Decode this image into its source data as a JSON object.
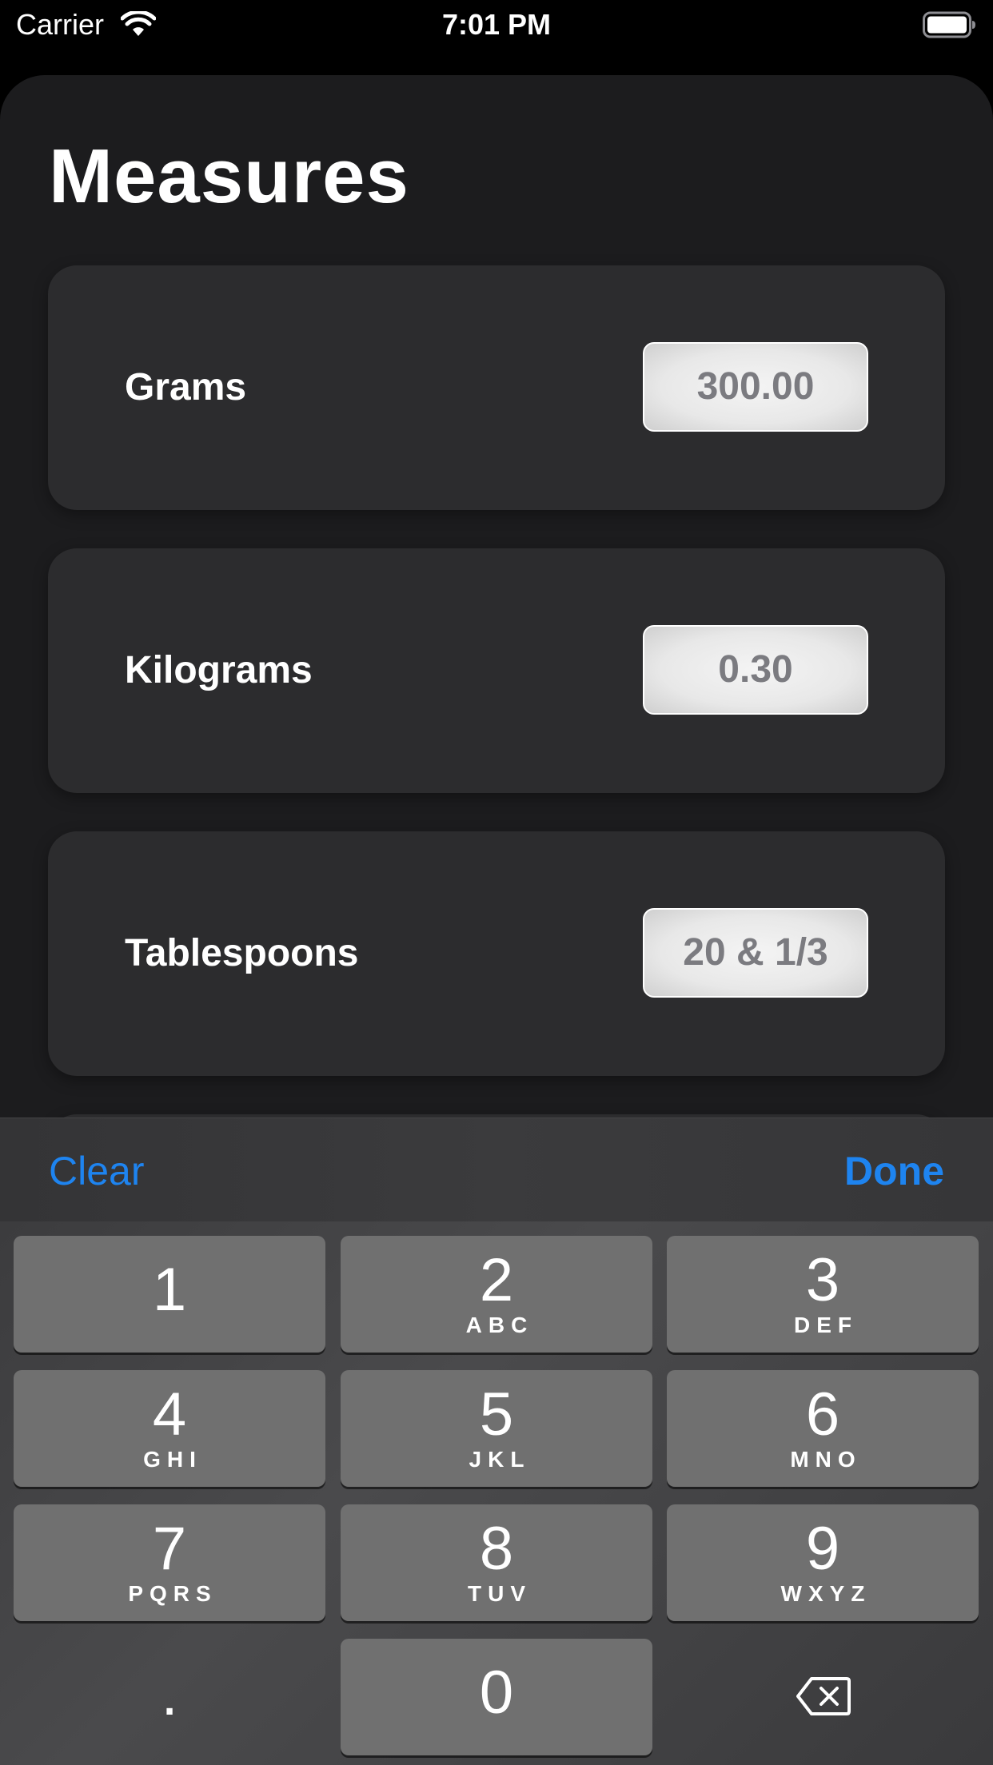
{
  "status_bar": {
    "carrier": "Carrier",
    "time": "7:01 PM",
    "icons": [
      "wifi-icon",
      "battery-icon"
    ]
  },
  "page": {
    "title": "Measures"
  },
  "measures": [
    {
      "label": "Grams",
      "value": "300.00"
    },
    {
      "label": "Kilograms",
      "value": "0.30"
    },
    {
      "label": "Tablespoons",
      "value": "20 & 1/3"
    }
  ],
  "toolbar": {
    "clear_label": "Clear",
    "done_label": "Done",
    "accent_color": "#1e84f0"
  },
  "keypad": {
    "keys": [
      {
        "digit": "1",
        "letters": ""
      },
      {
        "digit": "2",
        "letters": "ABC"
      },
      {
        "digit": "3",
        "letters": "DEF"
      },
      {
        "digit": "4",
        "letters": "GHI"
      },
      {
        "digit": "5",
        "letters": "JKL"
      },
      {
        "digit": "6",
        "letters": "MNO"
      },
      {
        "digit": "7",
        "letters": "PQRS"
      },
      {
        "digit": "8",
        "letters": "TUV"
      },
      {
        "digit": "9",
        "letters": "WXYZ"
      },
      {
        "digit": "0",
        "letters": ""
      }
    ],
    "decimal_key": ".",
    "delete_icon": "backspace-icon"
  },
  "colors": {
    "background": "#000000",
    "sheet": "#1c1c1e",
    "card": "#2c2c2e",
    "key": "#707070",
    "field_text": "#7b7b80"
  }
}
